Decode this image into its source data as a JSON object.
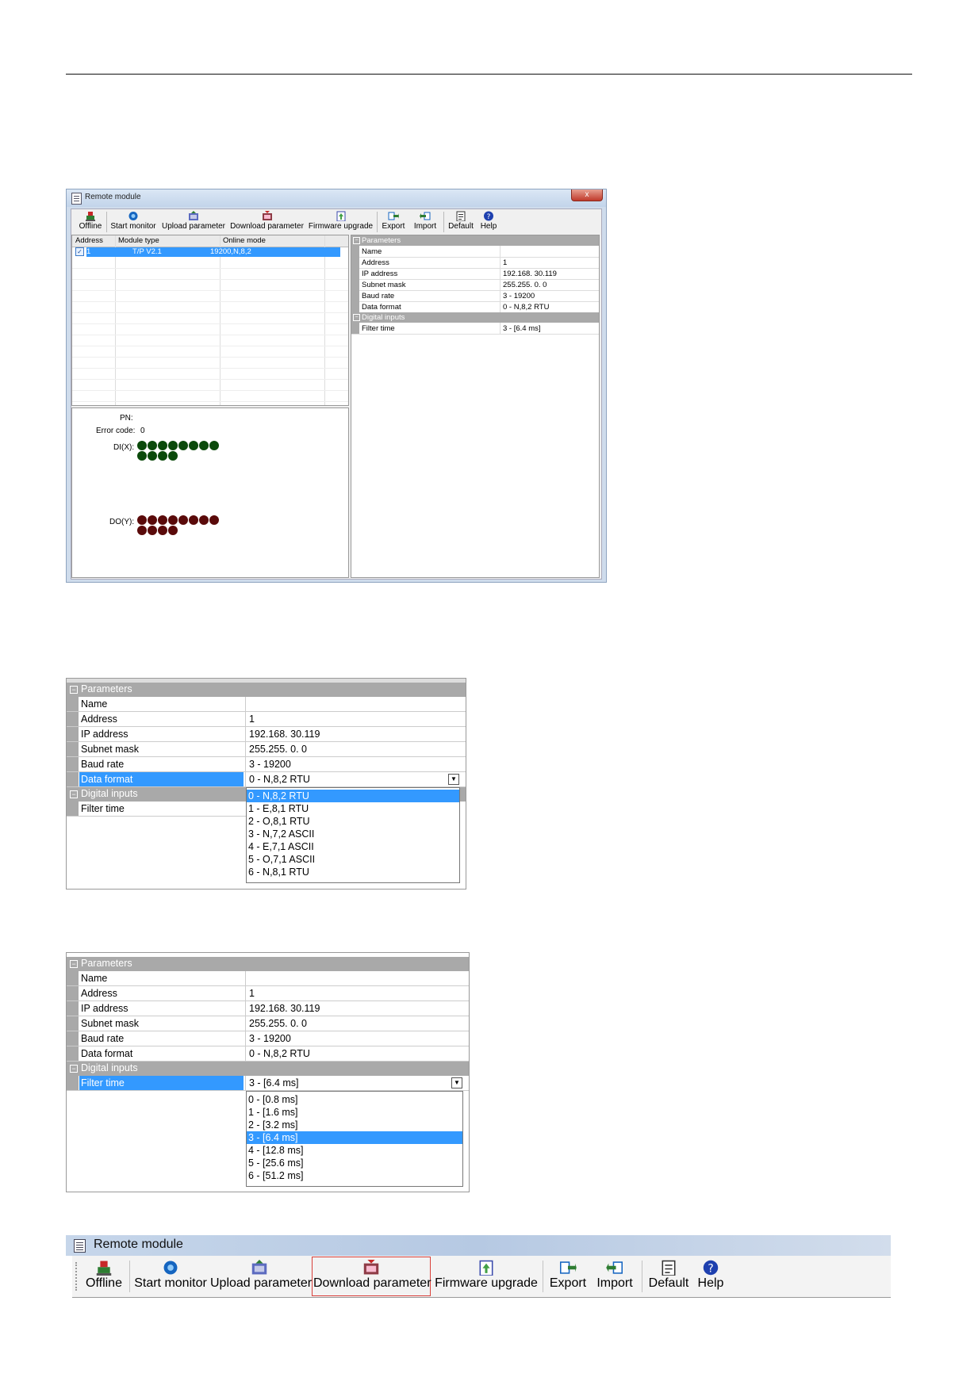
{
  "window": {
    "title": "Remote module",
    "close_label": "x"
  },
  "toolbar": [
    {
      "key": "offline",
      "label": "Offline",
      "icon": "offline-icon"
    },
    {
      "key": "start_monitor",
      "label": "Start monitor",
      "icon": "monitor-icon"
    },
    {
      "key": "upload",
      "label": "Upload parameter",
      "icon": "upload-icon"
    },
    {
      "key": "download",
      "label": "Download parameter",
      "icon": "download-icon"
    },
    {
      "key": "firmware",
      "label": "Firmware upgrade",
      "icon": "firmware-icon"
    },
    {
      "key": "export",
      "label": "Export",
      "icon": "export-icon"
    },
    {
      "key": "import",
      "label": "Import",
      "icon": "import-icon"
    },
    {
      "key": "default",
      "label": "Default",
      "icon": "default-icon"
    },
    {
      "key": "help",
      "label": "Help",
      "icon": "help-icon"
    }
  ],
  "module_table": {
    "columns": [
      "Address",
      "Module type",
      "Online mode"
    ],
    "rows": [
      {
        "address": "1",
        "module_type": "T/P V2.1",
        "online_mode": "19200,N,8,2",
        "checked": true
      }
    ]
  },
  "status": {
    "pn_label": "PN:",
    "pn_value": "",
    "error_label": "Error code:",
    "error_value": "0",
    "di_label": "DI(X):",
    "do_label": "DO(Y):",
    "di_count": 12,
    "do_count": 12,
    "di_color": "#0b4a0b",
    "do_color": "#5a0a0a"
  },
  "params": {
    "category_parameters": "Parameters",
    "category_digital": "Digital inputs",
    "name_label": "Name",
    "name_value": "",
    "address_label": "Address",
    "address_value": "1",
    "ip_label": "IP address",
    "ip_value": "192.168. 30.119",
    "subnet_label": "Subnet mask",
    "subnet_value": "255.255.  0.  0",
    "baud_label": "Baud rate",
    "baud_value": "3 - 19200",
    "format_label": "Data format",
    "format_value": "0 - N,8,2 RTU",
    "filter_label": "Filter time",
    "filter_value": "3 - [6.4 ms]"
  },
  "data_format_options": [
    "0 - N,8,2 RTU",
    "1 - E,8,1 RTU",
    "2 - O,8,1 RTU",
    "3 - N,7,2 ASCII",
    "4 - E,7,1 ASCII",
    "5 - O,7,1 ASCII",
    "6 - N,8,1 RTU"
  ],
  "data_format_selected_index": 0,
  "filter_time_options": [
    "0 - [0.8 ms]",
    "1 - [1.6 ms]",
    "2 - [3.2 ms]",
    "3 - [6.4 ms]",
    "4 - [12.8 ms]",
    "5 - [25.6 ms]",
    "6 - [51.2 ms]"
  ],
  "filter_time_selected_index": 3,
  "highlighted_toolbar_button": "download",
  "colors": {
    "selection": "#3399ff",
    "category": "#a9a9a9",
    "highlight_box": "#d9403a"
  }
}
